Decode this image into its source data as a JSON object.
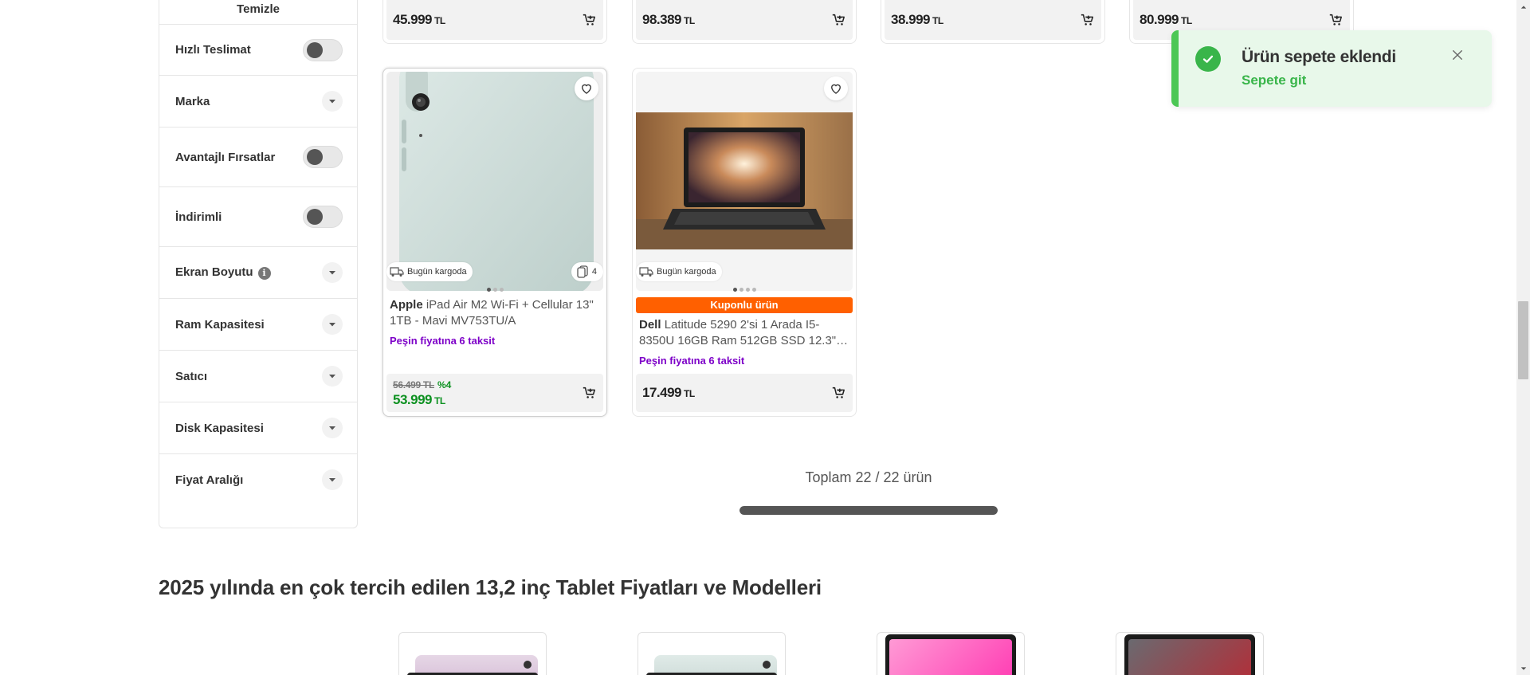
{
  "sidebar": {
    "clear_label": "Temizle",
    "filters": [
      {
        "label": "Hızlı Teslimat",
        "control": "toggle"
      },
      {
        "label": "Marka",
        "control": "dropdown"
      },
      {
        "label": "Avantajlı Fırsatlar",
        "control": "toggle"
      },
      {
        "label": "İndirimli",
        "control": "toggle"
      },
      {
        "label": "Ekran Boyutu",
        "control": "dropdown",
        "info": "i"
      },
      {
        "label": "Ram Kapasitesi",
        "control": "dropdown"
      },
      {
        "label": "Satıcı",
        "control": "dropdown"
      },
      {
        "label": "Disk Kapasitesi",
        "control": "dropdown"
      },
      {
        "label": "Fiyat Aralığı",
        "control": "dropdown"
      }
    ]
  },
  "top_row_prices": [
    {
      "price": "45.999",
      "currency": "TL"
    },
    {
      "price": "98.389",
      "currency": "TL"
    },
    {
      "price": "38.999",
      "currency": "TL"
    },
    {
      "price": "80.999",
      "currency": "TL"
    }
  ],
  "products": [
    {
      "brand": "Apple",
      "name": "iPad Air M2 Wi-Fi + Cellular 13\" 1TB - Mavi MV753TU/A",
      "cargo_badge": "Bugün kargoda",
      "count_badge": "4",
      "installment": "Peşin fiyatına 6 taksit",
      "old_price": "56.499 TL",
      "discount": "%4",
      "price": "53.999",
      "currency": "TL"
    },
    {
      "brand": "Dell",
      "name": "Latitude 5290 2'si 1 Arada I5-8350U 16GB Ram 512GB SSD 12.3\"…",
      "cargo_badge": "Bugün kargoda",
      "coupon": "Kuponlu ürün",
      "installment": "Peşin fiyatına 6 taksit",
      "price": "17.499",
      "currency": "TL"
    }
  ],
  "summary": {
    "total_text": "Toplam 22 / 22 ürün",
    "progress_fraction": 1.0
  },
  "section_title": "2025 yılında en çok tercih edilen 13,2 inç Tablet Fiyatları ve Modelleri",
  "toast": {
    "message": "Ürün sepete eklendi",
    "link": "Sepete git"
  },
  "colors": {
    "accent_orange": "#ff6000",
    "installment_purple": "#7d00c8",
    "discount_green": "#0d9121",
    "toast_green": "#39b54a",
    "toast_bg": "#e8f8ea"
  },
  "icons": [
    "cart-add-icon",
    "heart-icon",
    "cargo-truck-icon",
    "stack-icon",
    "chevron-down-icon",
    "info-icon",
    "check-circle-icon",
    "close-icon"
  ]
}
